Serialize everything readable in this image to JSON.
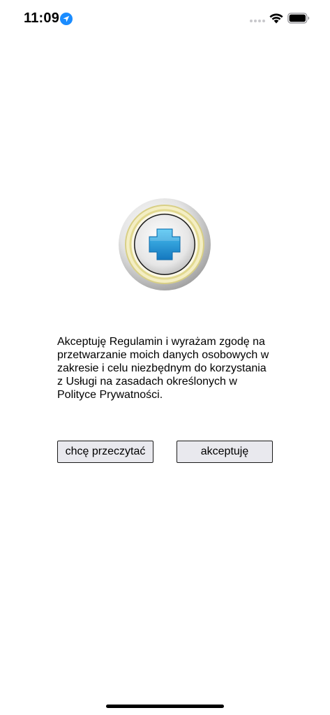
{
  "status_bar": {
    "time": "11:09",
    "icons": [
      "location-arrow-icon",
      "cellular-signal-icon",
      "wifi-icon",
      "battery-icon"
    ]
  },
  "logo": {
    "icon": "medical-cross-logo-icon",
    "cross_color": "#1f9ad6",
    "ring_color": "#e6dc9a"
  },
  "consent": {
    "text": "Akceptuję Regulamin i wyrażam zgodę na\nprzetwarzanie moich danych osobowych w\nzakresie i celu niezbędnym do korzystania\nz Usługi na zasadach określonych w\nPolityce Prywatności."
  },
  "buttons": {
    "read_label": "chcę przeczytać",
    "accept_label": "akceptuję"
  },
  "colors": {
    "accent_blue": "#1a8cff",
    "button_background": "#e9e9ee"
  }
}
